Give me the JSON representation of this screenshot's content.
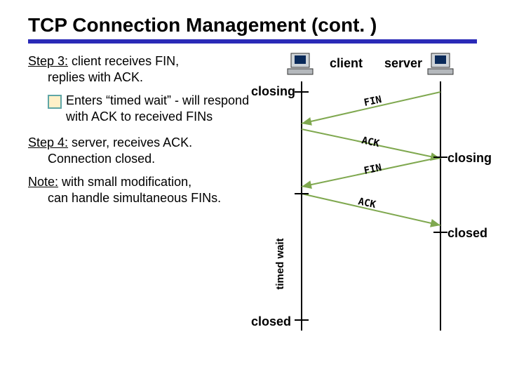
{
  "title": "TCP Connection Management (cont. )",
  "step3": {
    "label": "Step 3:",
    "text1": " client receives FIN,",
    "text2": "replies with ACK.",
    "bullet": "Enters “timed wait” - will respond with ACK to received FINs"
  },
  "step4": {
    "label": "Step 4:",
    "text1": " server, receives ACK.",
    "text2": "Connection closed."
  },
  "note": {
    "label": "Note:",
    "text1": " with small modification,",
    "text2": "can handle simultaneous FINs."
  },
  "diagram": {
    "client_label": "client",
    "server_label": "server",
    "state_client_closing": "closing",
    "state_server_closing": "closing",
    "state_client_closed": "closed",
    "state_server_closed": "closed",
    "msg_fin1": "FIN",
    "msg_ack1": "ACK",
    "msg_fin2": "FIN",
    "msg_ack2": "ACK",
    "timed_wait_label": "timed wait"
  }
}
